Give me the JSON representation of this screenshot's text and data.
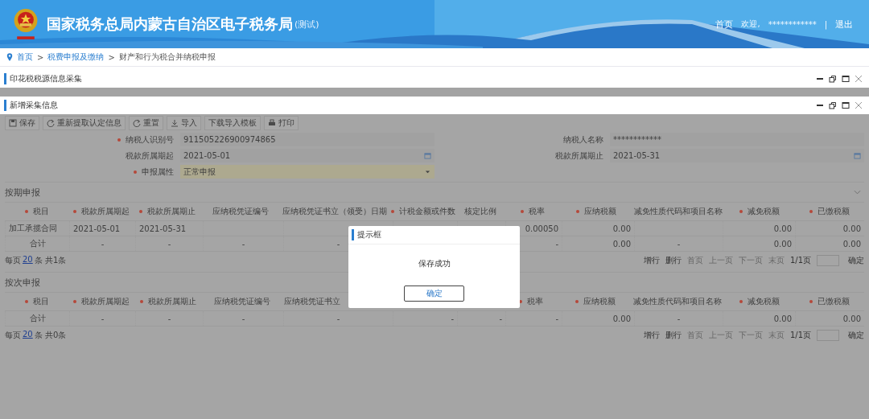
{
  "header": {
    "title": "国家税务总局内蒙古自治区电子税务局",
    "tag": "(测试)",
    "links": [
      {
        "kind": "link",
        "text": "首页"
      },
      {
        "kind": "text",
        "text": "欢迎,"
      },
      {
        "kind": "text",
        "text": "************"
      },
      {
        "kind": "sep",
        "text": "|"
      },
      {
        "kind": "link",
        "text": "退出"
      }
    ]
  },
  "breadcrumb": [
    {
      "text": "首页",
      "link": true
    },
    {
      "text": ">",
      "link": false
    },
    {
      "text": "税费申报及缴纳",
      "link": true
    },
    {
      "text": ">",
      "link": false
    },
    {
      "text": "财产和行为税合并纳税申报",
      "link": false
    }
  ],
  "panels": [
    {
      "title": "印花税税源信息采集"
    },
    {
      "title": "新增采集信息"
    }
  ],
  "toolbar": [
    "保存",
    "重新提取认定信息",
    "重置",
    "导入",
    "下载导入模板",
    "打印"
  ],
  "form": [
    {
      "label": "纳税人识别号",
      "required": true,
      "value": "911505226900974865",
      "kind": "readonly"
    },
    {
      "label": "纳税人名称",
      "required": false,
      "value": "************",
      "kind": "readonly"
    },
    {
      "label": "税款所属期起",
      "required": false,
      "value": "2021-05-01",
      "kind": "date"
    },
    {
      "label": "税款所属期止",
      "required": false,
      "value": "2021-05-31",
      "kind": "date"
    },
    {
      "label": "申报属性",
      "required": true,
      "value": "正常申报",
      "kind": "select"
    }
  ],
  "sections": [
    {
      "title": "按期申报",
      "collapsible": true,
      "columns": [
        {
          "label": "税目",
          "required": true
        },
        {
          "label": "税款所属期起",
          "required": true
        },
        {
          "label": "税款所属期止",
          "required": true
        },
        {
          "label": "应纳税凭证编号",
          "required": false
        },
        {
          "label": "应纳税凭证书立（领受）日期",
          "required": false
        },
        {
          "label": "计税金额或件数",
          "required": true
        },
        {
          "label": "核定比例",
          "required": false
        },
        {
          "label": "税率",
          "required": true
        },
        {
          "label": "应纳税额",
          "required": true
        },
        {
          "label": "减免性质代码和项目名称",
          "required": false
        },
        {
          "label": "减免税额",
          "required": true
        },
        {
          "label": "已缴税额",
          "required": true
        }
      ],
      "rows": [
        {
          "kind": "data",
          "cells": [
            "加工承揽合同",
            "2021-05-01",
            "2021-05-31",
            null,
            null,
            null,
            null,
            "0.00050",
            "0.00",
            null,
            "0.00",
            "0.00"
          ]
        },
        {
          "kind": "total",
          "cells": [
            "合计",
            "-",
            "-",
            "-",
            "-",
            null,
            null,
            "-",
            "0.00",
            "-",
            "0.00",
            "0.00"
          ]
        }
      ],
      "pager": {
        "prefix": "每页",
        "size": "20",
        "suffix": "条 共1条",
        "actions": [
          {
            "label": "增行",
            "disabled": false
          },
          {
            "label": "删行",
            "disabled": false
          },
          {
            "label": "首页",
            "disabled": true
          },
          {
            "label": "上一页",
            "disabled": true
          },
          {
            "label": "下一页",
            "disabled": true
          },
          {
            "label": "末页",
            "disabled": true
          }
        ],
        "page": "1/1页",
        "go": "确定"
      }
    },
    {
      "title": "按次申报",
      "collapsible": false,
      "columns": [
        {
          "label": "税目",
          "required": true
        },
        {
          "label": "税款所属期起",
          "required": true
        },
        {
          "label": "税款所属期止",
          "required": true
        },
        {
          "label": "应纳税凭证编号",
          "required": false
        },
        {
          "label": "应纳税凭证书立",
          "required": false
        },
        null,
        null,
        {
          "label": "税率",
          "required": true
        },
        {
          "label": "应纳税额",
          "required": true
        },
        {
          "label": "减免性质代码和项目名称",
          "required": false
        },
        {
          "label": "减免税额",
          "required": true
        },
        {
          "label": "已缴税额",
          "required": true
        }
      ],
      "rows": [
        {
          "kind": "total",
          "cells": [
            "合计",
            "-",
            "-",
            "-",
            "-",
            "-",
            "-",
            "-",
            "0.00",
            "-",
            "0.00",
            "0.00"
          ]
        }
      ],
      "pager": {
        "prefix": "每页",
        "size": "20",
        "suffix": "条 共0条",
        "actions": [
          {
            "label": "增行",
            "disabled": false
          },
          {
            "label": "删行",
            "disabled": false
          },
          {
            "label": "首页",
            "disabled": true
          },
          {
            "label": "上一页",
            "disabled": true
          },
          {
            "label": "下一页",
            "disabled": true
          },
          {
            "label": "末页",
            "disabled": true
          }
        ],
        "page": "1/1页",
        "go": "确定"
      }
    }
  ],
  "dialog": {
    "title": "提示框",
    "message": "保存成功",
    "button": "确定"
  }
}
